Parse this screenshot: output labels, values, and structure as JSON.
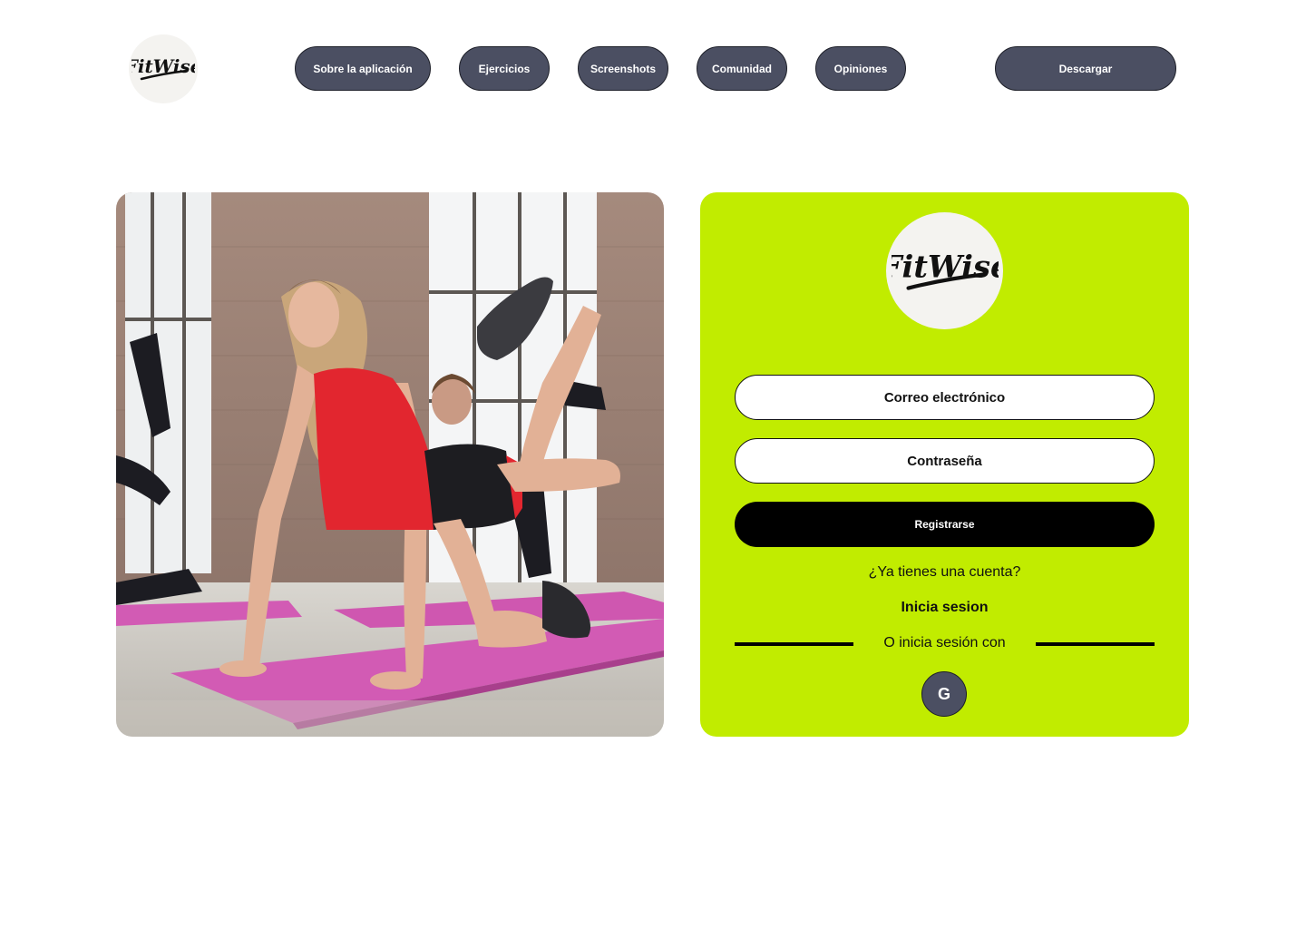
{
  "brand": {
    "name": "FitWise",
    "logo_icon": "fitwise-logo"
  },
  "nav": {
    "items": [
      {
        "label": "Sobre la aplicación"
      },
      {
        "label": "Ejercicios"
      },
      {
        "label": "Screenshots"
      },
      {
        "label": "Comunidad"
      },
      {
        "label": "Opiniones"
      }
    ],
    "download_label": "Descargar"
  },
  "hero_image": {
    "subject": "fitness-class-photo"
  },
  "form": {
    "email_placeholder": "Correo electrónico",
    "password_placeholder": "Contraseña",
    "register_label": "Registrarse",
    "have_account_text": "¿Ya tienes una cuenta?",
    "login_link_label": "Inicia sesion",
    "divider_text": "O inicia sesión con",
    "google_label": "G"
  },
  "colors": {
    "accent_lime": "#c1ec00",
    "nav_pill": "#4b4f62",
    "primary_button": "#000000",
    "mat_pink": "#d25bb4",
    "top_red": "#e2262f"
  }
}
